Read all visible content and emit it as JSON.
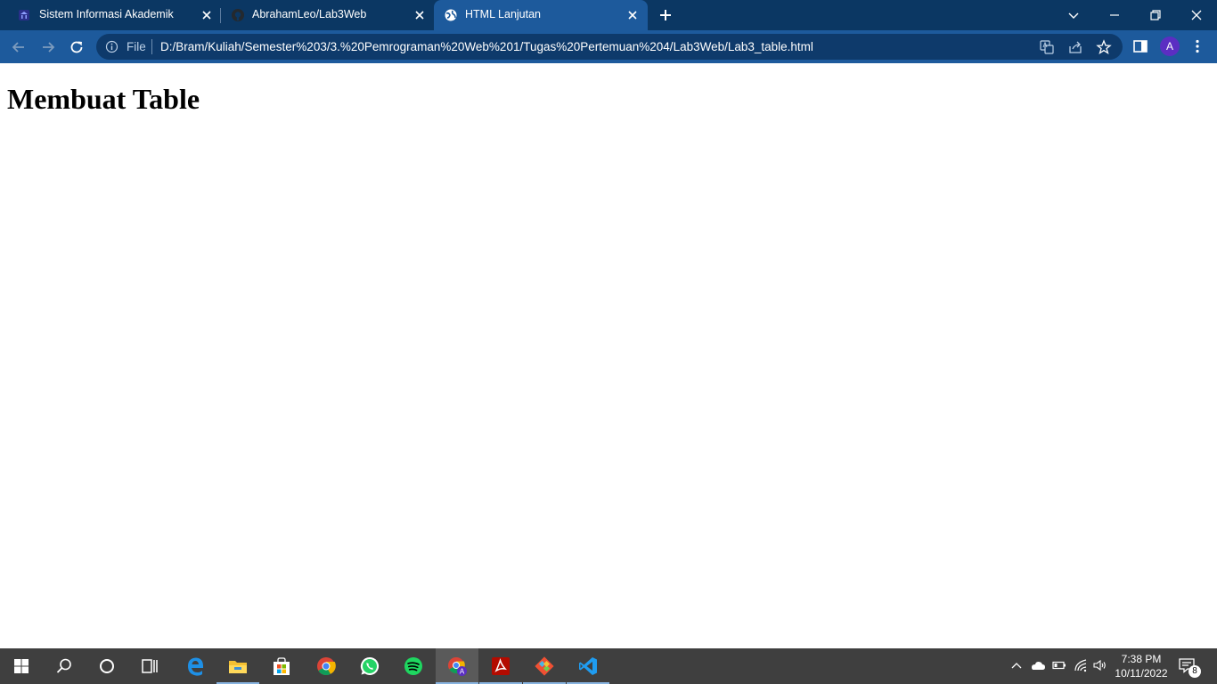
{
  "browser": {
    "tabs": [
      {
        "title": "Sistem Informasi Akademik",
        "icon": "university-icon",
        "active": false
      },
      {
        "title": "AbrahamLeo/Lab3Web",
        "icon": "github-icon",
        "active": false
      },
      {
        "title": "HTML Lanjutan",
        "icon": "globe-icon",
        "active": true
      }
    ],
    "address": {
      "scheme_label": "File",
      "url": "D:/Bram/Kuliah/Semester%203/3.%20Pemrograman%20Web%201/Tugas%20Pertemuan%204/Lab3Web/Lab3_table.html"
    },
    "profile_initial": "A"
  },
  "page": {
    "heading": "Membuat Table"
  },
  "taskbar": {
    "apps": [
      "windows-start",
      "search",
      "cortana",
      "task-view",
      "edge",
      "file-explorer",
      "microsoft-store",
      "chrome",
      "whatsapp",
      "spotify",
      "chrome-profile",
      "acrobat",
      "git",
      "vscode"
    ],
    "clock_time": "7:38 PM",
    "clock_date": "10/11/2022",
    "notification_count": "8"
  },
  "colors": {
    "tabstrip": "#0b3763",
    "toolbar": "#1d5a9c",
    "omnibox": "#0e3a6b",
    "taskbar": "#3f3f3f"
  }
}
